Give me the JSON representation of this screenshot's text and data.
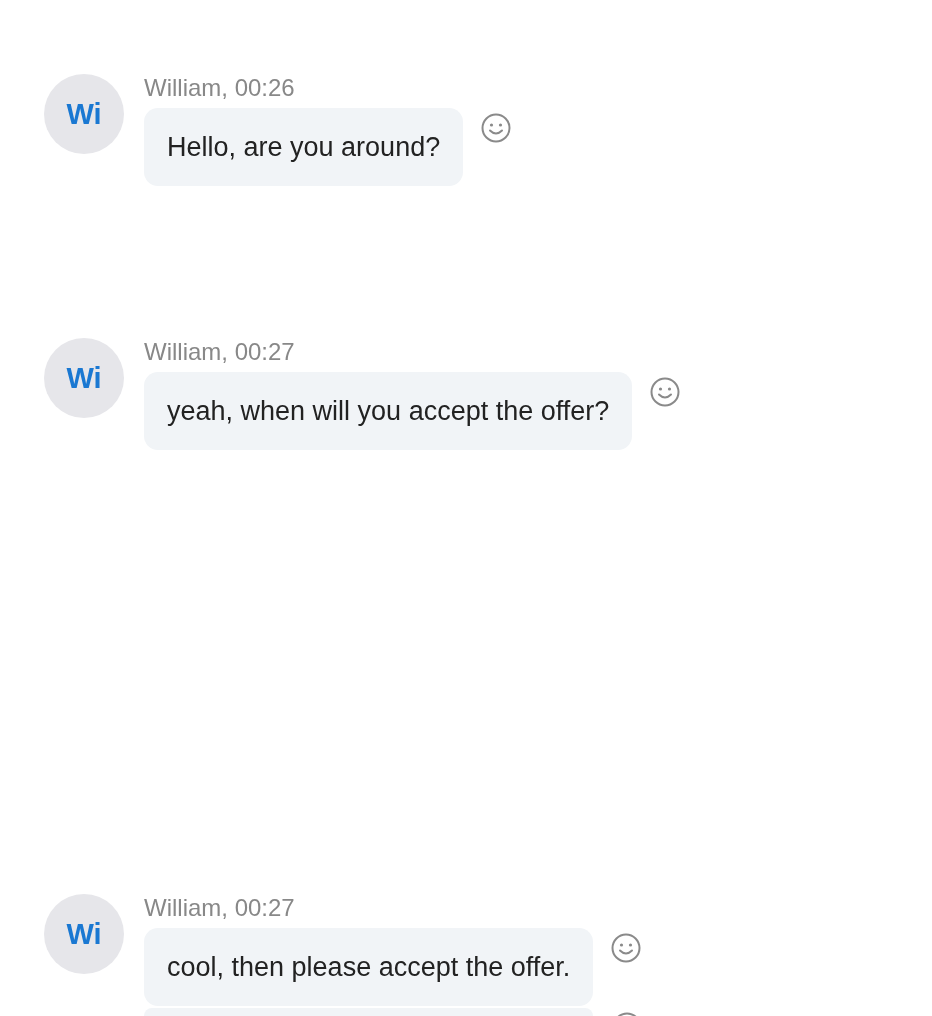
{
  "messages": [
    {
      "avatar": "Wi",
      "meta": "William, 00:26",
      "bubbles": [
        {
          "text": "Hello, are you around?",
          "cut_off": false
        }
      ]
    },
    {
      "avatar": "Wi",
      "meta": "William, 00:27",
      "bubbles": [
        {
          "text": "yeah, when will you accept the offer?",
          "cut_off": false
        }
      ]
    },
    {
      "avatar": "Wi",
      "meta": "William, 00:27",
      "bubbles": [
        {
          "text": "cool, then please accept the offer.",
          "cut_off": false
        },
        {
          "cut_off": true
        }
      ]
    }
  ]
}
